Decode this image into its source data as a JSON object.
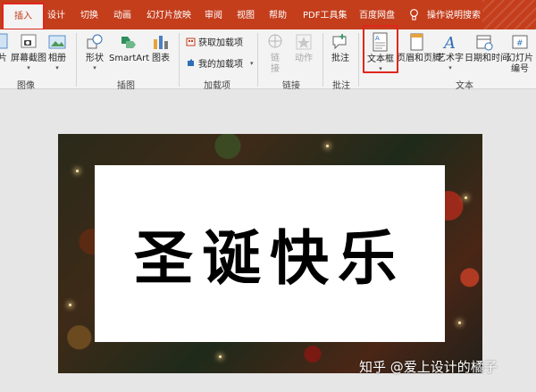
{
  "tabs": [
    {
      "label": "插入",
      "active": true
    },
    {
      "label": "设计"
    },
    {
      "label": "切换"
    },
    {
      "label": "动画"
    },
    {
      "label": "幻灯片放映"
    },
    {
      "label": "审阅"
    },
    {
      "label": "视图"
    },
    {
      "label": "帮助"
    },
    {
      "label": "PDF工具集"
    },
    {
      "label": "百度网盘"
    }
  ],
  "tell_me": "操作说明搜索",
  "ribbon": {
    "image_group": {
      "partial_btn": "片",
      "screenshot": "屏幕截图",
      "album": "相册",
      "label": "图像"
    },
    "illustration_group": {
      "shapes": "形状",
      "smartart": "SmartArt",
      "chart": "图表",
      "label": "插图"
    },
    "addins_group": {
      "get_addins": "获取加载项",
      "my_addins": "我的加载项",
      "label": "加载项"
    },
    "links_group": {
      "link_l1": "链",
      "link_l2": "接",
      "action": "动作",
      "label": "链接"
    },
    "comments_group": {
      "comment": "批注",
      "label": "批注"
    },
    "text_group": {
      "textbox": "文本框",
      "header_footer": "页眉和页脚",
      "wordart": "艺术字",
      "datetime": "日期和时间",
      "slide_number_l1": "幻灯片",
      "slide_number_l2": "编号",
      "label": "文本"
    }
  },
  "slide": {
    "title": "圣诞快乐"
  },
  "watermark": "知乎 @爱上设计的橘子",
  "colors": {
    "accent": "#c43e1c",
    "highlight": "#e0271e"
  }
}
